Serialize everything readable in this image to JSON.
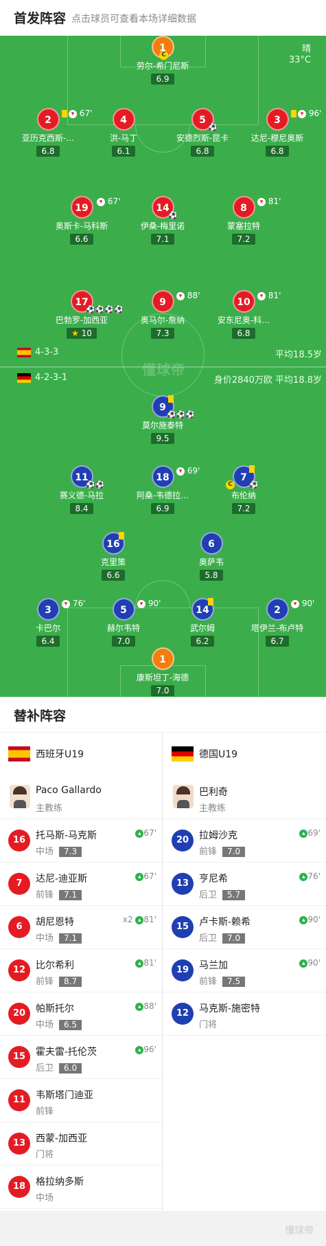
{
  "header": {
    "title": "首发阵容",
    "subtitle": "点击球员可查看本场详细数据"
  },
  "weather": {
    "condition": "晴",
    "temp": "33°C"
  },
  "watermark": "懂球帝",
  "spain": {
    "formation": "4-3-3",
    "avg_age": "平均18.5岁",
    "players": [
      {
        "num": "1",
        "name": "劳尔-希门尼斯",
        "rating": "6.9",
        "captain": "C"
      },
      {
        "num": "2",
        "name": "亚历克西斯-…",
        "rating": "6.8",
        "event": "67'"
      },
      {
        "num": "4",
        "name": "洪-马丁",
        "rating": "6.1"
      },
      {
        "num": "5",
        "name": "安德烈斯-昆卡",
        "rating": "6.8"
      },
      {
        "num": "3",
        "name": "达尼-穆尼奥斯",
        "rating": "6.8",
        "event": "96'"
      },
      {
        "num": "19",
        "name": "奥斯卡-马科斯",
        "rating": "6.6",
        "event": "67'"
      },
      {
        "num": "14",
        "name": "伊桑-梅里诺",
        "rating": "7.1"
      },
      {
        "num": "8",
        "name": "蒙塞拉特",
        "rating": "7.2",
        "event": "81'"
      },
      {
        "num": "17",
        "name": "巴勃罗-加西亚",
        "rating": "10"
      },
      {
        "num": "9",
        "name": "奥马尔-詹纳",
        "rating": "7.3",
        "event": "88'"
      },
      {
        "num": "10",
        "name": "安东尼奥-科…",
        "rating": "6.8",
        "event": "81'"
      }
    ]
  },
  "germany": {
    "formation": "4-2-3-1",
    "value_age": "身价2840万欧 平均18.8岁",
    "players": [
      {
        "num": "9",
        "name": "莫尔施泰特",
        "rating": "9.5"
      },
      {
        "num": "11",
        "name": "赛义德-马拉",
        "rating": "8.4"
      },
      {
        "num": "18",
        "name": "阿桑-韦德拉…",
        "rating": "6.9",
        "event": "69'"
      },
      {
        "num": "7",
        "name": "布伦纳",
        "rating": "7.2",
        "captain": "C"
      },
      {
        "num": "16",
        "name": "克里策",
        "rating": "6.6"
      },
      {
        "num": "6",
        "name": "奥萨韦",
        "rating": "5.8"
      },
      {
        "num": "3",
        "name": "卡巴尔",
        "rating": "6.4",
        "event": "76'"
      },
      {
        "num": "5",
        "name": "赫尔韦特",
        "rating": "7.0",
        "event": "90'"
      },
      {
        "num": "14",
        "name": "武尔姆",
        "rating": "6.2"
      },
      {
        "num": "2",
        "name": "塔伊兰-布卢特",
        "rating": "6.7",
        "event": "90'"
      },
      {
        "num": "1",
        "name": "康斯坦丁-海德",
        "rating": "7.0"
      }
    ]
  },
  "bench": {
    "title": "替补阵容",
    "left": {
      "team": "西班牙U19",
      "coach": "Paco Gallardo",
      "coach_role": "主教练",
      "subs": [
        {
          "num": "16",
          "name": "托马斯-马克斯",
          "pos": "中场",
          "rating": "7.3",
          "event": "67'"
        },
        {
          "num": "7",
          "name": "达尼-迪亚斯",
          "pos": "前锋",
          "rating": "7.1",
          "event": "67'"
        },
        {
          "num": "6",
          "name": "胡尼恩特",
          "pos": "中场",
          "rating": "7.1",
          "event": "x2",
          "event2": "81'"
        },
        {
          "num": "12",
          "name": "比尔希利",
          "pos": "前锋",
          "rating": "8.7",
          "event": "81'"
        },
        {
          "num": "20",
          "name": "帕斯托尔",
          "pos": "中场",
          "rating": "6.5",
          "event": "88'"
        },
        {
          "num": "15",
          "name": "霍夫雷-托伦茨",
          "pos": "后卫",
          "rating": "6.0",
          "event": "96'"
        },
        {
          "num": "11",
          "name": "韦斯塔门迪亚",
          "pos": "前锋"
        },
        {
          "num": "13",
          "name": "西蒙-加西亚",
          "pos": "门将"
        },
        {
          "num": "18",
          "name": "格拉纳多斯",
          "pos": "中场"
        }
      ]
    },
    "right": {
      "team": "德国U19",
      "coach": "巴利奇",
      "coach_role": "主教练",
      "subs": [
        {
          "num": "20",
          "name": "拉姆沙克",
          "pos": "前锋",
          "rating": "7.0",
          "event": "69'"
        },
        {
          "num": "13",
          "name": "亨尼希",
          "pos": "后卫",
          "rating": "5.7",
          "event": "76'"
        },
        {
          "num": "15",
          "name": "卢卡斯-赖希",
          "pos": "后卫",
          "rating": "7.0",
          "event": "90'"
        },
        {
          "num": "19",
          "name": "马兰加",
          "pos": "前锋",
          "rating": "7.5",
          "event": "90'"
        },
        {
          "num": "12",
          "name": "马克斯-施密特",
          "pos": "门将"
        }
      ]
    }
  },
  "footer": {
    "logo": "懂球帝"
  }
}
